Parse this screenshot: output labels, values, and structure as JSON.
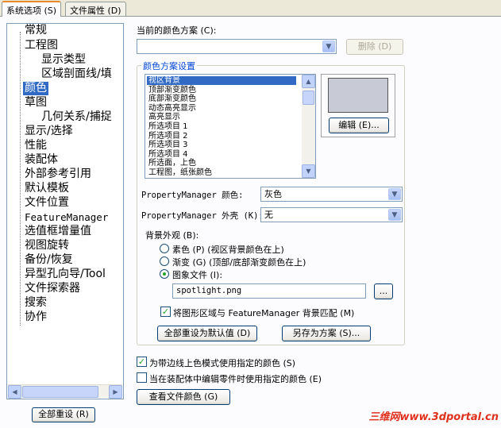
{
  "tabs": [
    {
      "label": "系统选项 (S)"
    },
    {
      "label": "文件属性 (D)"
    }
  ],
  "tree": {
    "items": [
      {
        "label": "常规",
        "level": 0
      },
      {
        "label": "工程图",
        "level": 0
      },
      {
        "label": "显示类型",
        "level": 1
      },
      {
        "label": "区域剖面线/填",
        "level": 1
      },
      {
        "label": "颜色",
        "level": 0,
        "selected": true
      },
      {
        "label": "草图",
        "level": 0
      },
      {
        "label": "几何关系/捕捉",
        "level": 1
      },
      {
        "label": "显示/选择",
        "level": 0
      },
      {
        "label": "性能",
        "level": 0
      },
      {
        "label": "装配体",
        "level": 0
      },
      {
        "label": "外部参考引用",
        "level": 0
      },
      {
        "label": "默认模板",
        "level": 0
      },
      {
        "label": "文件位置",
        "level": 0
      },
      {
        "label": "FeatureManager",
        "level": 0
      },
      {
        "label": "选值框增量值",
        "level": 0
      },
      {
        "label": "视图旋转",
        "level": 0
      },
      {
        "label": "备份/恢复",
        "level": 0
      },
      {
        "label": "异型孔向导/Tool",
        "level": 0
      },
      {
        "label": "文件探索器",
        "level": 0
      },
      {
        "label": "搜索",
        "level": 0
      },
      {
        "label": "协作",
        "level": 0
      }
    ]
  },
  "reset_all_label": "全部重设 (R)",
  "color_scheme": {
    "label": "当前的颜色方案 (C):",
    "value": "",
    "delete_label": "删除 (D)"
  },
  "scheme_group": {
    "title": "颜色方案设置",
    "list_items": [
      {
        "label": "视区背景",
        "selected": true
      },
      {
        "label": "顶部渐变颜色"
      },
      {
        "label": "底部渐变颜色"
      },
      {
        "label": "动态高亮显示"
      },
      {
        "label": "高亮显示"
      },
      {
        "label": "所选项目 1"
      },
      {
        "label": "所选项目 2"
      },
      {
        "label": "所选项目 3"
      },
      {
        "label": "所选项目 4"
      },
      {
        "label": "所选面，上色"
      },
      {
        "label": "工程图，纸张颜色"
      }
    ],
    "swatch_color": "#c8cad6",
    "edit_label": "编辑 (E)...",
    "pm_color_label": "PropertyManager 颜色:",
    "pm_color_value": "灰色",
    "pm_skin_label": "PropertyManager 外壳 (K):",
    "pm_skin_value": "无",
    "background_label": "背景外观 (B):",
    "radio_plain": "素色 (P) (视区背景颜色在上)",
    "radio_gradient": "渐变 (G) (顶部/底部渐变颜色在上)",
    "radio_image": "图象文件 (I):",
    "image_file": "spotlight.png",
    "browse_label": "...",
    "match_label": "将图形区域与 FeatureManager 背景匹配 (M)",
    "reset_defaults_label": "全部重设为默认值 (D)",
    "save_as_label": "另存为方案 (S)..."
  },
  "options": {
    "shaded_edges_label": "为带边线上色模式使用指定的颜色 (S)",
    "assembly_edit_label": "当在装配体中编辑零件时使用指定的颜色 (E)",
    "view_doc_colors_label": "查看文件颜色 (G)"
  },
  "watermark": "三维网www.3dportal.cn"
}
